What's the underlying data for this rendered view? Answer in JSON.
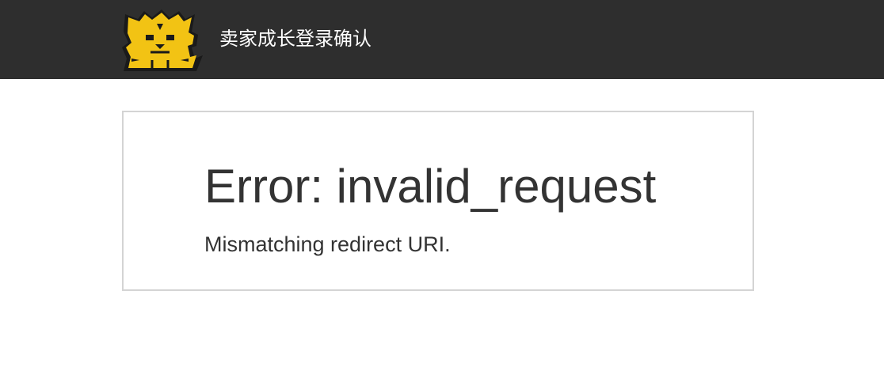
{
  "header": {
    "logo_icon": "tiger-logo-icon",
    "title": "卖家成长登录确认",
    "background": "#2e2e2e",
    "logo_color": "#f2c314"
  },
  "error": {
    "title": "Error: invalid_request",
    "message": "Mismatching redirect URI."
  }
}
